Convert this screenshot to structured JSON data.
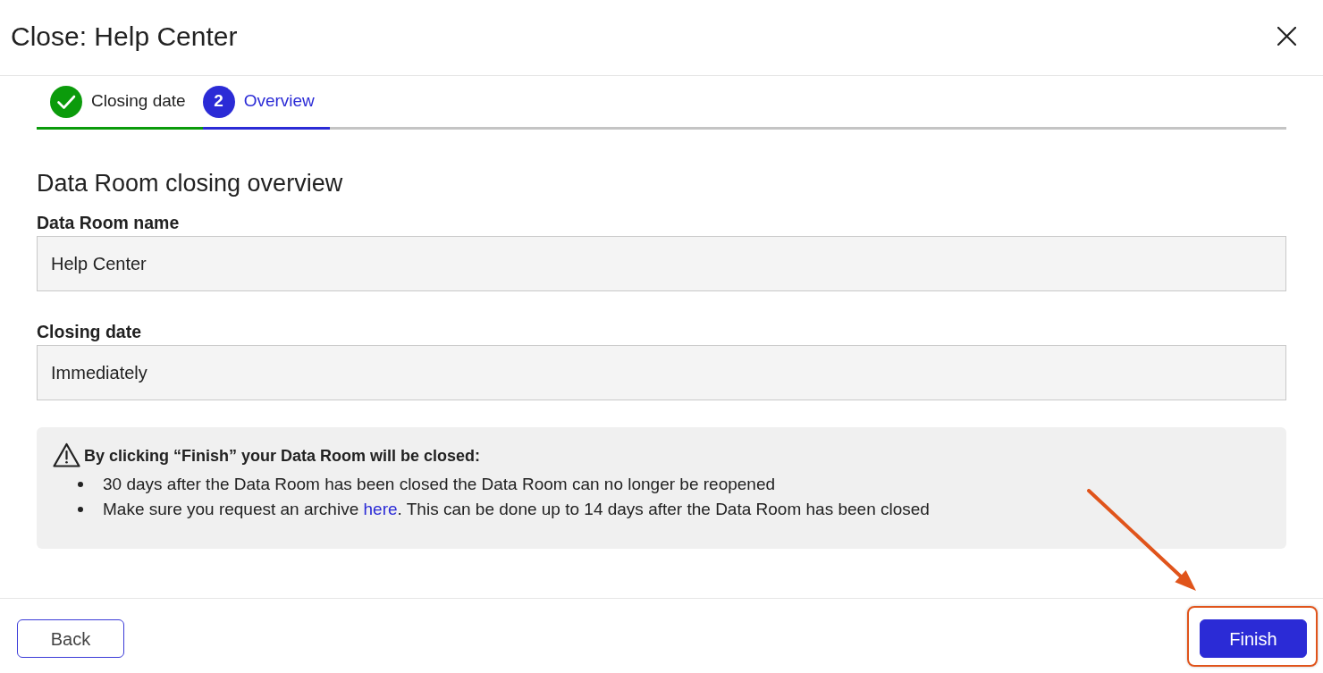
{
  "dialog": {
    "title": "Close: Help Center"
  },
  "steps": [
    {
      "label": "Closing date",
      "completed": true,
      "selected": false
    },
    {
      "label": "Overview",
      "number": "2",
      "completed": false,
      "selected": true
    }
  ],
  "overview": {
    "heading": "Data Room closing overview",
    "fields": [
      {
        "label": "Data Room name",
        "value": "Help Center",
        "disabled": true
      },
      {
        "label": "Closing date",
        "value": "Immediately",
        "disabled": true
      }
    ]
  },
  "notice": {
    "title": "By clicking “Finish” your Data Room will be closed:",
    "items": [
      {
        "text": "30 days after the Data Room has been closed the Data Room can no longer be reopened"
      },
      {
        "text": "Make sure you request an archive ",
        "link": "here",
        "text_after": ". This can be done up to 14 days after the Data Room has been closed"
      }
    ]
  },
  "footer": {
    "buttons": [
      {
        "label": "Back",
        "kind": "secondary",
        "highlighted": false
      },
      {
        "label": "Finish",
        "kind": "primary",
        "highlighted": true
      }
    ]
  }
}
